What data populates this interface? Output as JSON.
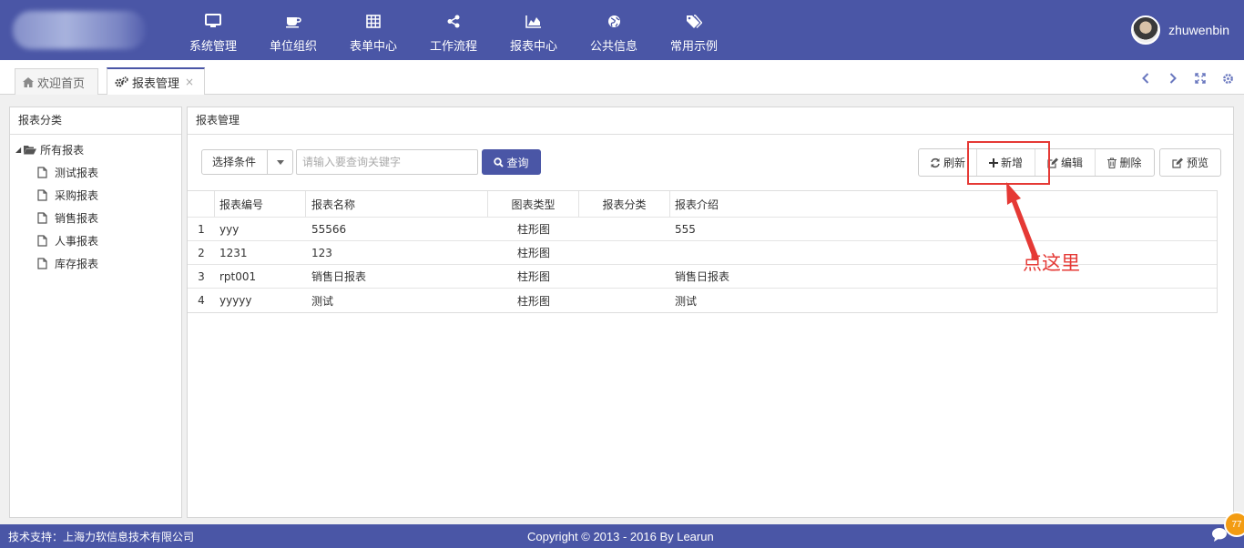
{
  "header": {
    "nav": [
      {
        "label": "系统管理",
        "icon": "monitor-icon"
      },
      {
        "label": "单位组织",
        "icon": "coffee-icon"
      },
      {
        "label": "表单中心",
        "icon": "table-icon"
      },
      {
        "label": "工作流程",
        "icon": "share-icon"
      },
      {
        "label": "报表中心",
        "icon": "area-chart-icon"
      },
      {
        "label": "公共信息",
        "icon": "globe-icon"
      },
      {
        "label": "常用示例",
        "icon": "tags-icon"
      }
    ],
    "username": "zhuwenbin"
  },
  "tabs": [
    {
      "label": "欢迎首页",
      "icon": "home-icon"
    },
    {
      "label": "报表管理",
      "icon": "cogs-icon",
      "close": "×"
    }
  ],
  "sidebar": {
    "title": "报表分类",
    "root": "所有报表",
    "items": [
      "测试报表",
      "采购报表",
      "销售报表",
      "人事报表",
      "库存报表"
    ]
  },
  "main": {
    "title": "报表管理",
    "condition_label": "选择条件",
    "search_placeholder": "请输入要查询关键字",
    "query_label": "查询",
    "buttons": {
      "refresh": "刷新",
      "add": "新增",
      "edit": "编辑",
      "delete": "删除",
      "preview": "预览"
    },
    "annotation": "点这里",
    "columns": [
      "报表编号",
      "报表名称",
      "图表类型",
      "报表分类",
      "报表介绍"
    ],
    "rows": [
      {
        "n": "1",
        "code": "yyy",
        "name": "55566",
        "type": "柱形图",
        "category": "",
        "intro": "555"
      },
      {
        "n": "2",
        "code": "1231",
        "name": "123",
        "type": "柱形图",
        "category": "",
        "intro": ""
      },
      {
        "n": "3",
        "code": "rpt001",
        "name": "销售日报表",
        "type": "柱形图",
        "category": "",
        "intro": "销售日报表"
      },
      {
        "n": "4",
        "code": "yyyyy",
        "name": "测试",
        "type": "柱形图",
        "category": "",
        "intro": "测试"
      }
    ]
  },
  "footer": {
    "support": "技术支持：上海力软信息技术有限公司",
    "copyright": "Copyright © 2013 - 2016 By Learun",
    "badge": "77"
  },
  "colors": {
    "primary": "#4a56a6",
    "annotation": "#e53935"
  }
}
